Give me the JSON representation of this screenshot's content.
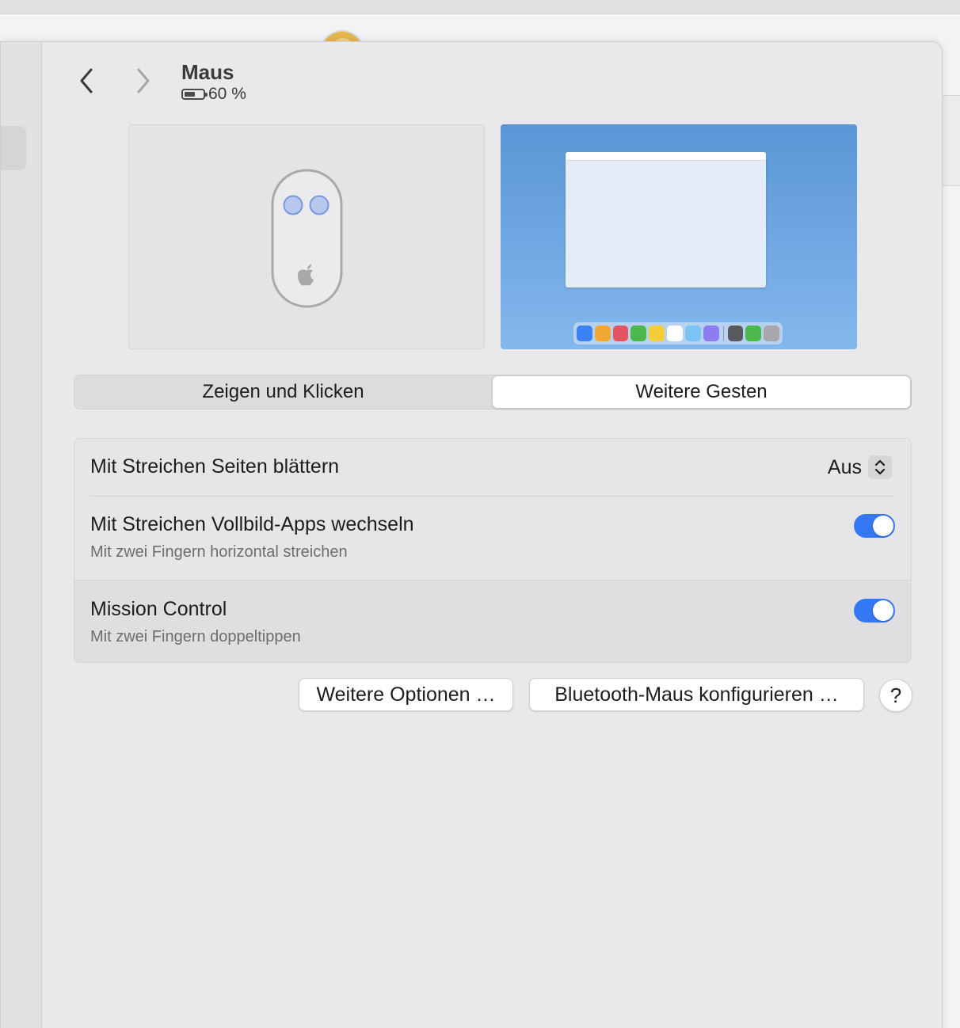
{
  "header": {
    "title": "Maus",
    "battery_text": "60 %",
    "battery_level": 0.6
  },
  "tabs": [
    {
      "label": "Zeigen und Klicken",
      "active": false
    },
    {
      "label": "Weitere Gesten",
      "active": true
    }
  ],
  "settings": {
    "swipe_pages": {
      "label": "Mit Streichen Seiten blättern",
      "value": "Aus"
    },
    "swipe_fullscreen": {
      "label": "Mit Streichen Vollbild-Apps wechseln",
      "subtitle": "Mit zwei Fingern horizontal streichen",
      "enabled": true
    },
    "mission_control": {
      "label": "Mission Control",
      "subtitle": "Mit zwei Fingern doppeltippen",
      "enabled": true
    }
  },
  "buttons": {
    "more_options": "Weitere Optionen …",
    "bluetooth_setup": "Bluetooth-Maus konfigurieren …",
    "help": "?"
  },
  "colors": {
    "accent": "#3478f6",
    "preview_blue_top": "#5a95d6",
    "preview_blue_bottom": "#83b8ec"
  },
  "icons": {
    "back": "chevron-left-icon",
    "forward": "chevron-right-icon",
    "battery": "battery-icon",
    "mouse": "magic-mouse-icon",
    "apple": "apple-logo-icon"
  },
  "dock_colors": [
    "#3b82f6",
    "#f0a830",
    "#e25563",
    "#4cb84c",
    "#f5cd38",
    "#ffffff",
    "#7cc4f4",
    "#8c7ef2",
    "#5a5a5e",
    "#4cb84c",
    "#a8a8ac"
  ]
}
